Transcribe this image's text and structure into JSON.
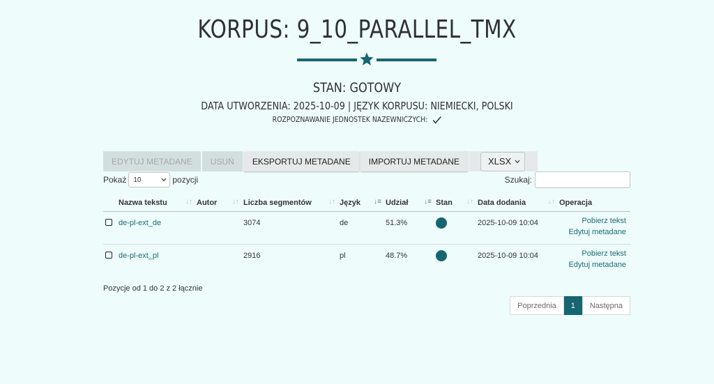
{
  "header": {
    "title": "KORPUS: 9_10_PARALLEL_TMX",
    "state": "STAN: GOTOWY",
    "meta": "DATA UTWORZENIA: 2025-10-09 | JĘZYK KORPUSU: NIEMIECKI, POLSKI",
    "ner": "ROZPOZNAWANIE JEDNOSTEK NAZEWNICZYCH:"
  },
  "toolbar": {
    "edit_metadata": "EDYTUJ METADANE",
    "delete": "USUŃ",
    "export_metadata": "EKSPORTUJ METADANE",
    "import_metadata": "IMPORTUJ METADANE",
    "format_value": "XLSX"
  },
  "controls": {
    "show_prefix": "Pokaż",
    "show_value": "10",
    "show_suffix": "pozycji",
    "search_label": "Szukaj:"
  },
  "table": {
    "columns": [
      "Nazwa tekstu",
      "Autor",
      "Liczba segmentów",
      "Język",
      "Udział",
      "Stan",
      "Data dodania",
      "Operacja"
    ],
    "rows": [
      {
        "name": "de-pl-ext_de",
        "author": "",
        "segments": "3074",
        "lang": "de",
        "share": "51.3%",
        "date": "2025-10-09 10:04",
        "op1": "Pobierz tekst",
        "op2": "Edytuj metadane"
      },
      {
        "name": "de-pl-ext_pl",
        "author": "",
        "segments": "2916",
        "lang": "pl",
        "share": "48.7%",
        "date": "2025-10-09 10:04",
        "op1": "Pobierz tekst",
        "op2": "Edytuj metadane"
      }
    ]
  },
  "footer": {
    "info": "Pozycje od 1 do 2 z 2 łącznie",
    "prev": "Poprzednia",
    "page": "1",
    "next": "Następna"
  },
  "colors": {
    "accent": "#166570",
    "background": "#eefcfb"
  }
}
